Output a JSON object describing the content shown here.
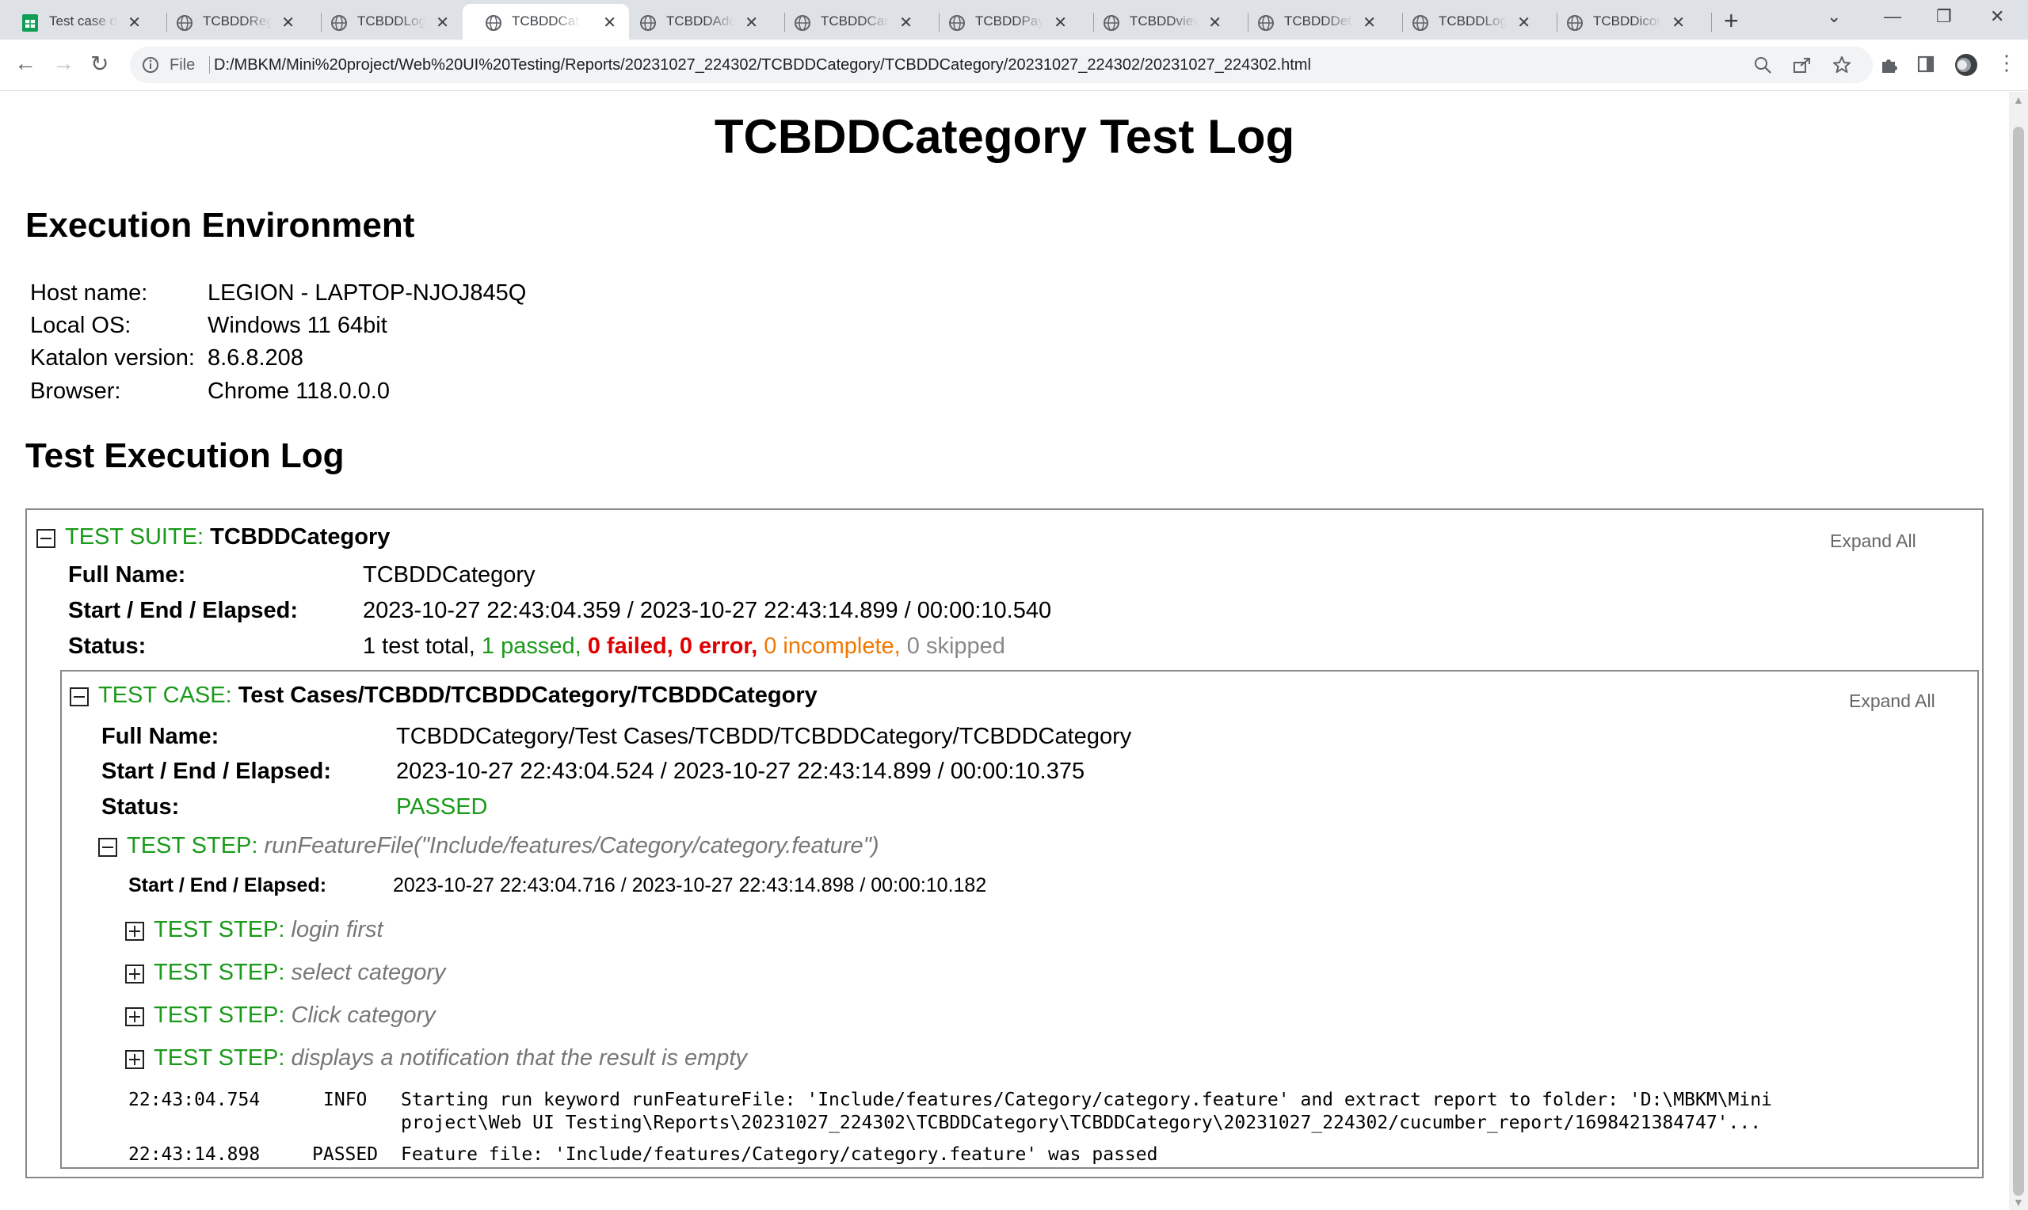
{
  "browser": {
    "tabs": [
      {
        "title": "Test case de",
        "icon": "sheets-icon",
        "active": false
      },
      {
        "title": "TCBDDRegister",
        "icon": "globe-icon",
        "active": false
      },
      {
        "title": "TCBDDLogin",
        "icon": "globe-icon",
        "active": false
      },
      {
        "title": "TCBDDCategory",
        "icon": "globe-icon",
        "active": true
      },
      {
        "title": "TCBDDAddItem",
        "icon": "globe-icon",
        "active": false
      },
      {
        "title": "TCBDDCart",
        "icon": "globe-icon",
        "active": false
      },
      {
        "title": "TCBDDPayment",
        "icon": "globe-icon",
        "active": false
      },
      {
        "title": "TCBDDview",
        "icon": "globe-icon",
        "active": false
      },
      {
        "title": "TCBDDDetail",
        "icon": "globe-icon",
        "active": false
      },
      {
        "title": "TCBDDLogout",
        "icon": "globe-icon",
        "active": false
      },
      {
        "title": "TCBDDicon",
        "icon": "globe-icon",
        "active": false
      }
    ],
    "address": {
      "scheme_label": "File",
      "url": "D:/MBKM/Mini%20project/Web%20UI%20Testing/Reports/20231027_224302/TCBDDCategory/TCBDDCategory/20231027_224302/20231027_224302.html"
    }
  },
  "report": {
    "title": "TCBDDCategory Test Log",
    "env_heading": "Execution Environment",
    "env": [
      {
        "label": "Host name:",
        "value": "LEGION - LAPTOP-NJOJ845Q"
      },
      {
        "label": "Local OS:",
        "value": "Windows 11 64bit"
      },
      {
        "label": "Katalon version:",
        "value": "8.6.8.208"
      },
      {
        "label": "Browser:",
        "value": "Chrome 118.0.0.0"
      }
    ],
    "log_heading": "Test Execution Log",
    "suite": {
      "kind": "TEST SUITE:",
      "name": "TCBDDCategory",
      "expand_all": "Expand All",
      "full_name_label": "Full Name:",
      "full_name": "TCBDDCategory",
      "timing_label": "Start / End / Elapsed:",
      "timing": "2023-10-27 22:43:04.359 / 2023-10-27 22:43:14.899 / 00:00:10.540",
      "status_label": "Status:",
      "status": {
        "total": "1 test total,",
        "passed": "1 passed,",
        "failed": "0 failed,",
        "error": "0 error,",
        "incomplete": "0 incomplete,",
        "skipped": "0 skipped"
      }
    },
    "case": {
      "kind": "TEST CASE:",
      "name": "Test Cases/TCBDD/TCBDDCategory/TCBDDCategory",
      "expand_all": "Expand All",
      "full_name_label": "Full Name:",
      "full_name": "TCBDDCategory/Test Cases/TCBDD/TCBDDCategory/TCBDDCategory",
      "timing_label": "Start / End / Elapsed:",
      "timing": "2023-10-27 22:43:04.524 / 2023-10-27 22:43:14.899 / 00:00:10.375",
      "status_label": "Status:",
      "status": "PASSED"
    },
    "main_step": {
      "kind": "TEST STEP:",
      "name": "runFeatureFile(\"Include/features/Category/category.feature\")",
      "timing_label": "Start / End / Elapsed:",
      "timing": "2023-10-27 22:43:04.716 / 2023-10-27 22:43:14.898 / 00:00:10.182"
    },
    "substeps": [
      {
        "kind": "TEST STEP:",
        "name": "login first"
      },
      {
        "kind": "TEST STEP:",
        "name": "select category"
      },
      {
        "kind": "TEST STEP:",
        "name": "Click category"
      },
      {
        "kind": "TEST STEP:",
        "name": "displays a notification that the result is empty"
      }
    ],
    "logs": [
      {
        "time": "22:43:04.754",
        "level": "INFO",
        "line1": "Starting run keyword runFeatureFile: 'Include/features/Category/category.feature' and extract report to folder: 'D:\\MBKM\\Mini",
        "line2": "project\\Web UI Testing\\Reports\\20231027_224302\\TCBDDCategory\\TCBDDCategory\\20231027_224302/cucumber_report/1698421384747'..."
      },
      {
        "time": "22:43:14.898",
        "level": "PASSED",
        "line1": "Feature file: 'Include/features/Category/category.feature' was passed"
      }
    ]
  },
  "colors": {
    "kind_green": "#1a9a1a",
    "failed_red": "#e00000",
    "incomplete_orange": "#f07800",
    "skipped_grey": "#888888"
  }
}
